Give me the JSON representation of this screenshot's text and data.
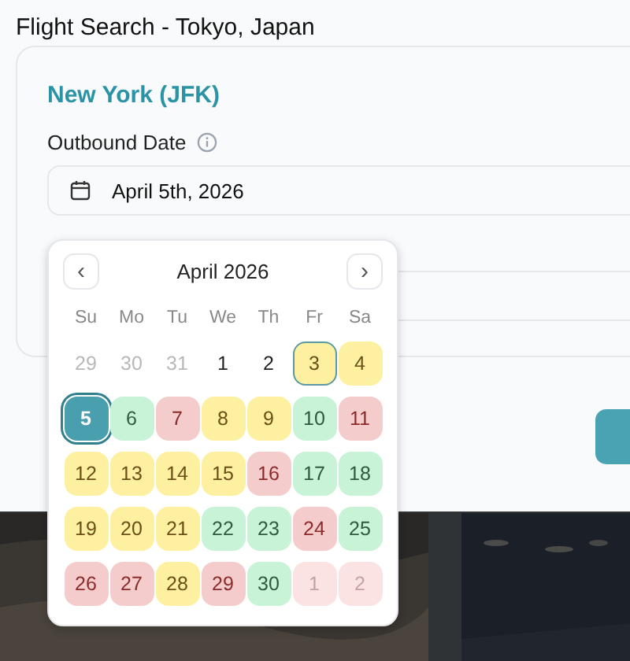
{
  "page_title": "Flight Search - Tokyo, Japan",
  "origin": "New York (JFK)",
  "outbound": {
    "label": "Outbound Date",
    "value": "April 5th, 2026"
  },
  "calendar": {
    "month": "April 2026",
    "prev": "‹",
    "next": "›",
    "weekdays": [
      "Su",
      "Mo",
      "Tu",
      "We",
      "Th",
      "Fr",
      "Sa"
    ],
    "days": [
      {
        "label": "29",
        "outside": true,
        "selected": false,
        "today": false
      },
      {
        "label": "30",
        "outside": true,
        "selected": false,
        "today": false
      },
      {
        "label": "31",
        "outside": true,
        "selected": false,
        "today": false
      },
      {
        "label": "1",
        "outside": false,
        "selected": false,
        "today": false
      },
      {
        "label": "2",
        "outside": false,
        "selected": false,
        "today": false
      },
      {
        "label": "3",
        "outside": false,
        "selected": false,
        "today": true,
        "color": "#fdf0a0"
      },
      {
        "label": "4",
        "outside": false,
        "selected": false,
        "today": false,
        "color": "#fdf0a0"
      },
      {
        "label": "5",
        "outside": false,
        "selected": true,
        "today": false
      },
      {
        "label": "6",
        "outside": false,
        "selected": false,
        "today": false,
        "color": "#c8f3d6"
      },
      {
        "label": "7",
        "outside": false,
        "selected": false,
        "today": false,
        "color": "#f5cccc"
      },
      {
        "label": "8",
        "outside": false,
        "selected": false,
        "today": false,
        "color": "#fdf0a0"
      },
      {
        "label": "9",
        "outside": false,
        "selected": false,
        "today": false,
        "color": "#fdf0a0"
      },
      {
        "label": "10",
        "outside": false,
        "selected": false,
        "today": false,
        "color": "#c8f3d6"
      },
      {
        "label": "11",
        "outside": false,
        "selected": false,
        "today": false,
        "color": "#f5cccc"
      },
      {
        "label": "12",
        "outside": false,
        "selected": false,
        "today": false,
        "color": "#fdf0a0"
      },
      {
        "label": "13",
        "outside": false,
        "selected": false,
        "today": false,
        "color": "#fdf0a0"
      },
      {
        "label": "14",
        "outside": false,
        "selected": false,
        "today": false,
        "color": "#fdf0a0"
      },
      {
        "label": "15",
        "outside": false,
        "selected": false,
        "today": false,
        "color": "#fdf0a0"
      },
      {
        "label": "16",
        "outside": false,
        "selected": false,
        "today": false,
        "color": "#f5cccc"
      },
      {
        "label": "17",
        "outside": false,
        "selected": false,
        "today": false,
        "color": "#c8f3d6"
      },
      {
        "label": "18",
        "outside": false,
        "selected": false,
        "today": false,
        "color": "#c8f3d6"
      },
      {
        "label": "19",
        "outside": false,
        "selected": false,
        "today": false,
        "color": "#fdf0a0"
      },
      {
        "label": "20",
        "outside": false,
        "selected": false,
        "today": false,
        "color": "#fdf0a0"
      },
      {
        "label": "21",
        "outside": false,
        "selected": false,
        "today": false,
        "color": "#fdf0a0"
      },
      {
        "label": "22",
        "outside": false,
        "selected": false,
        "today": false,
        "color": "#c8f3d6"
      },
      {
        "label": "23",
        "outside": false,
        "selected": false,
        "today": false,
        "color": "#c8f3d6"
      },
      {
        "label": "24",
        "outside": false,
        "selected": false,
        "today": false,
        "color": "#f5cccc"
      },
      {
        "label": "25",
        "outside": false,
        "selected": false,
        "today": false,
        "color": "#c8f3d6"
      },
      {
        "label": "26",
        "outside": false,
        "selected": false,
        "today": false,
        "color": "#f5cccc"
      },
      {
        "label": "27",
        "outside": false,
        "selected": false,
        "today": false,
        "color": "#f5cccc"
      },
      {
        "label": "28",
        "outside": false,
        "selected": false,
        "today": false,
        "color": "#fdf0a0"
      },
      {
        "label": "29",
        "outside": false,
        "selected": false,
        "today": false,
        "color": "#f5cccc"
      },
      {
        "label": "30",
        "outside": false,
        "selected": false,
        "today": false,
        "color": "#c8f3d6"
      },
      {
        "label": "1",
        "outside": true,
        "selected": false,
        "today": false,
        "color": "#fbe3e3"
      },
      {
        "label": "2",
        "outside": true,
        "selected": false,
        "today": false,
        "color": "#fbe3e3"
      }
    ]
  }
}
